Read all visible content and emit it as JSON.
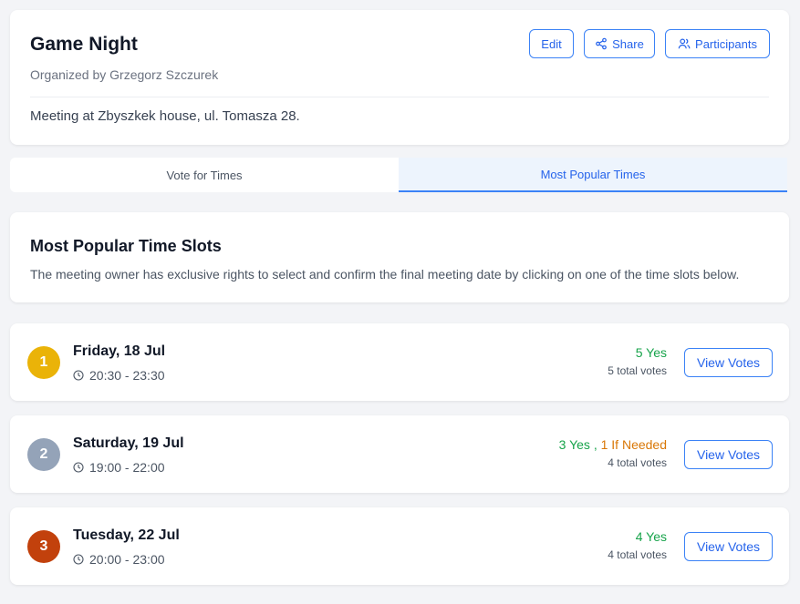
{
  "meeting": {
    "title": "Game Night",
    "organizer": "Organized by Grzegorz Szczurek",
    "description": "Meeting at Zbyszkek house, ul. Tomasza 28."
  },
  "actions": {
    "edit": "Edit",
    "share": "Share",
    "participants": "Participants"
  },
  "tabs": [
    {
      "label": "Vote for Times",
      "active": false
    },
    {
      "label": "Most Popular Times",
      "active": true
    }
  ],
  "popular": {
    "title": "Most Popular Time Slots",
    "description": "The meeting owner has exclusive rights to select and confirm the final meeting date by clicking on one of the time slots below."
  },
  "slots": [
    {
      "rank": "1",
      "rank_color": "#eab308",
      "date": "Friday, 18 Jul",
      "time": "20:30 - 23:30",
      "yes": "5 Yes",
      "separator": "",
      "if_needed": "",
      "total": "5 total votes",
      "button": "View Votes"
    },
    {
      "rank": "2",
      "rank_color": "#94a3b8",
      "date": "Saturday, 19 Jul",
      "time": "19:00 - 22:00",
      "yes": "3 Yes",
      "separator": " , ",
      "if_needed": "1 If Needed",
      "total": "4 total votes",
      "button": "View Votes"
    },
    {
      "rank": "3",
      "rank_color": "#c2410c",
      "date": "Tuesday, 22 Jul",
      "time": "20:00 - 23:00",
      "yes": "4 Yes",
      "separator": "",
      "if_needed": "",
      "total": "4 total votes",
      "button": "View Votes"
    }
  ],
  "colors": {
    "accent": "#2563eb",
    "yes": "#16a34a",
    "if_needed": "#d97706"
  },
  "icons": {
    "share": "share-icon",
    "participants": "users-icon",
    "time": "clock-icon"
  }
}
